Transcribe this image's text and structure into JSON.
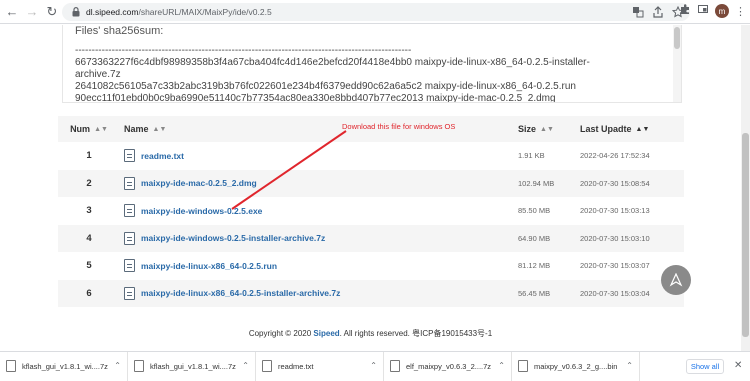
{
  "browser": {
    "url_host": "dl.sipeed.com",
    "url_path": "/shareURL/MAIX/MaixPy/ide/v0.2.5",
    "avatar_letter": "m"
  },
  "hashes": {
    "title": "Files' sha256sum:",
    "lines": [
      "-----------------------------------------------------------------------------------------------------",
      "6673363227f6c4dbf98989358b3f4a67cba404fc4d146e2befcd20f4418e4bb0 maixpy-ide-linux-x86_64-0.2.5-installer-",
      "archive.7z",
      "2641082c56105a7c33b2abc319b3b76fc022601e234b4f6379edd90c62a6a5c2 maixpy-ide-linux-x86_64-0.2.5.run",
      "90ecc11f01ebd0b0c9ba6990e51140c7b77354ac80ea330e8bbd407b77ec2013 maixpy-ide-mac-0.2.5_2.dmg"
    ]
  },
  "table": {
    "headers": {
      "num": "Num",
      "name": "Name",
      "size": "Size",
      "date": "Last Upadte"
    },
    "rows": [
      {
        "num": "1",
        "name": "readme.txt",
        "size": "1.91 KB",
        "date": "2022-04-26 17:52:34"
      },
      {
        "num": "2",
        "name": "maixpy-ide-mac-0.2.5_2.dmg",
        "size": "102.94 MB",
        "date": "2020-07-30 15:08:54"
      },
      {
        "num": "3",
        "name": "maixpy-ide-windows-0.2.5.exe",
        "size": "85.50 MB",
        "date": "2020-07-30 15:03:13"
      },
      {
        "num": "4",
        "name": "maixpy-ide-windows-0.2.5-installer-archive.7z",
        "size": "64.90 MB",
        "date": "2020-07-30 15:03:10"
      },
      {
        "num": "5",
        "name": "maixpy-ide-linux-x86_64-0.2.5.run",
        "size": "81.12 MB",
        "date": "2020-07-30 15:03:07"
      },
      {
        "num": "6",
        "name": "maixpy-ide-linux-x86_64-0.2.5-installer-archive.7z",
        "size": "56.45 MB",
        "date": "2020-07-30 15:03:04"
      }
    ]
  },
  "annotation": {
    "text": "Download this file for windows OS",
    "color": "#e0262d"
  },
  "footer": {
    "prefix": "Copyright © 2020 ",
    "brand": "Sipeed",
    "suffix": ". All rights reserved. 粤ICP备19015433号-1"
  },
  "downloads": {
    "items": [
      "kflash_gui_v1.8.1_wi....7z",
      "kflash_gui_v1.8.1_wi....7z",
      "readme.txt",
      "elf_maixpy_v0.6.3_2....7z",
      "maixpy_v0.6.3_2_g....bin"
    ],
    "show_all": "Show all"
  },
  "colors": {
    "link": "#2a6aa8",
    "accent": "#1a73e8"
  }
}
